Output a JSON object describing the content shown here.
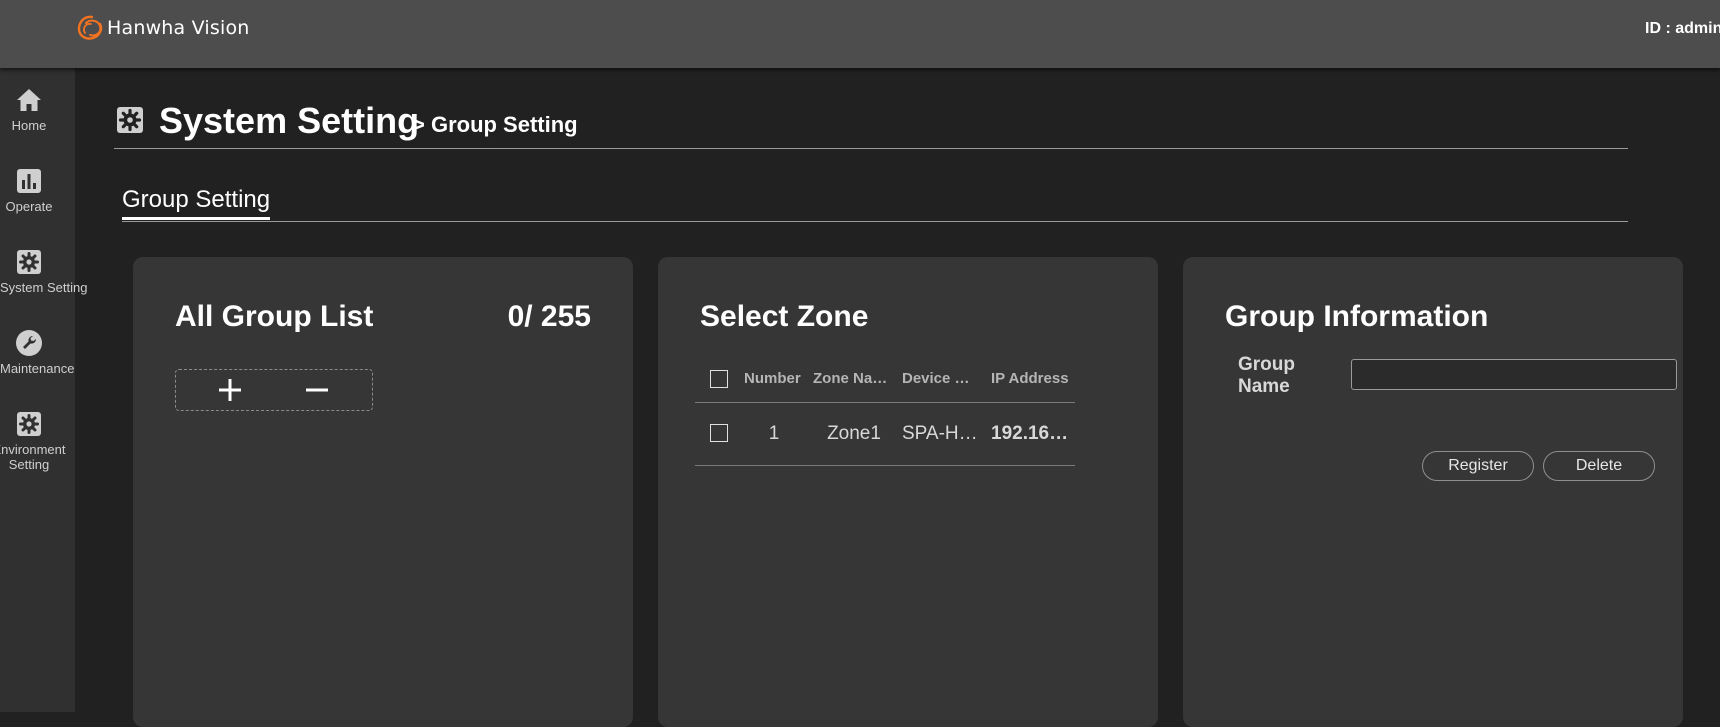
{
  "header": {
    "brand": "Hanwha Vision",
    "user_id": "ID : admin"
  },
  "sidebar": {
    "items": [
      {
        "label": "Home",
        "icon": "home-icon"
      },
      {
        "label": "Operate",
        "icon": "bar-chart-icon"
      },
      {
        "label": "System Setting",
        "icon": "gear-icon"
      },
      {
        "label": "Maintenance",
        "icon": "wrench-icon"
      },
      {
        "label": "Environment Setting",
        "icon": "gear-icon"
      }
    ]
  },
  "page": {
    "title": "System Setting",
    "subtitle": "> Group Setting",
    "tab": "Group Setting"
  },
  "group_list": {
    "title": "All Group List",
    "count": "0/ 255",
    "add_icon": "plus-icon",
    "remove_icon": "minus-icon"
  },
  "select_zone": {
    "title": "Select Zone",
    "columns": [
      "Number",
      "Zone Name",
      "Device Name",
      "IP Address"
    ],
    "rows": [
      {
        "number": "1",
        "zone_name": "Zone1",
        "device_name": "SPA-H…",
        "ip_address": "192.16…"
      }
    ]
  },
  "group_info": {
    "title": "Group Information",
    "name_label": "Group Name",
    "name_value": "",
    "register_label": "Register",
    "delete_label": "Delete"
  },
  "colors": {
    "topbar": "#4d4d4e",
    "sidebar": "#303030",
    "background": "#212121",
    "panel": "#363636",
    "brand_orange": "#f37321"
  }
}
